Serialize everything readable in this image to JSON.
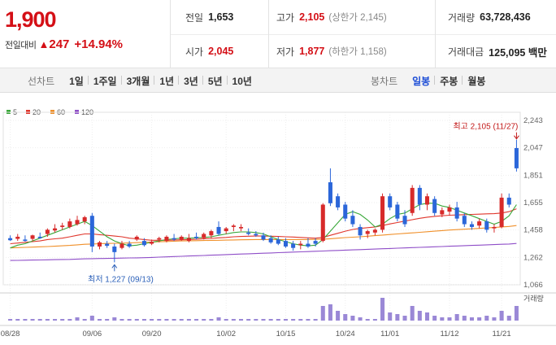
{
  "price": {
    "current": "1,900",
    "change_label": "전일대비",
    "arrow": "▲",
    "change": "247",
    "change_pct": "+14.94%"
  },
  "stats": {
    "prev_close_label": "전일",
    "prev_close": "1,653",
    "open_label": "시가",
    "open": "2,045",
    "high_label": "고가",
    "high": "2,105",
    "upper_limit": "(상한가 2,145)",
    "low_label": "저가",
    "low": "1,877",
    "lower_limit": "(하한가 1,158)",
    "volume_label": "거래량",
    "volume": "63,728,436",
    "amount_label": "거래대금",
    "amount": "125,095 백만"
  },
  "toolbar": {
    "period_label": "선차트",
    "periods": [
      "1일",
      "1주일",
      "3개월",
      "1년",
      "3년",
      "5년",
      "10년"
    ],
    "candle_label": "봉차트",
    "candles": [
      "일봉",
      "주봉",
      "월봉"
    ],
    "active_candle": "일봉"
  },
  "colors": {
    "up": "#d72a2a",
    "down": "#2b66d9",
    "ma5": "#3aa83a",
    "ma20": "#e0362c",
    "ma60": "#f0902a",
    "ma120": "#8f4ec8"
  },
  "chart_data": {
    "type": "candlestick",
    "legend": [
      "5",
      "20",
      "60",
      "120"
    ],
    "y_ticks": [
      "2,243",
      "2,047",
      "1,851",
      "1,655",
      "1,458",
      "1,262",
      "1,066"
    ],
    "ylim": [
      1066,
      2243
    ],
    "x_ticks": [
      "08/28",
      "09/06",
      "09/20",
      "10/02",
      "10/15",
      "10/24",
      "11/01",
      "11/12",
      "11/21"
    ],
    "annotations": {
      "high": "최고 2,105 (11/27)",
      "low": "최저 1,227 (09/13)"
    },
    "volume_label": "거래량",
    "candles": [
      [
        1400,
        1420,
        1380,
        1385
      ],
      [
        1395,
        1430,
        1380,
        1410
      ],
      [
        1390,
        1420,
        1375,
        1380
      ],
      [
        1395,
        1425,
        1380,
        1420
      ],
      [
        1410,
        1440,
        1395,
        1400
      ],
      [
        1430,
        1470,
        1410,
        1460
      ],
      [
        1455,
        1500,
        1440,
        1470
      ],
      [
        1480,
        1510,
        1460,
        1490
      ],
      [
        1480,
        1540,
        1470,
        1520
      ],
      [
        1500,
        1560,
        1490,
        1530
      ],
      [
        1520,
        1560,
        1500,
        1550
      ],
      [
        1560,
        1580,
        1300,
        1340
      ],
      [
        1340,
        1380,
        1320,
        1370
      ],
      [
        1360,
        1380,
        1330,
        1345
      ],
      [
        1340,
        1360,
        1227,
        1300
      ],
      [
        1330,
        1380,
        1320,
        1360
      ],
      [
        1360,
        1380,
        1330,
        1340
      ],
      [
        1390,
        1420,
        1380,
        1410
      ],
      [
        1380,
        1400,
        1340,
        1350
      ],
      [
        1360,
        1390,
        1350,
        1375
      ],
      [
        1390,
        1410,
        1370,
        1400
      ],
      [
        1380,
        1420,
        1370,
        1410
      ],
      [
        1400,
        1430,
        1380,
        1390
      ],
      [
        1390,
        1420,
        1380,
        1410
      ],
      [
        1380,
        1430,
        1370,
        1400
      ],
      [
        1410,
        1440,
        1390,
        1400
      ],
      [
        1400,
        1440,
        1390,
        1430
      ],
      [
        1420,
        1460,
        1400,
        1450
      ],
      [
        1480,
        1520,
        1420,
        1430
      ],
      [
        1450,
        1480,
        1430,
        1470
      ],
      [
        1480,
        1500,
        1450,
        1490
      ],
      [
        1470,
        1500,
        1450,
        1480
      ],
      [
        1440,
        1470,
        1420,
        1430
      ],
      [
        1430,
        1450,
        1410,
        1420
      ],
      [
        1420,
        1440,
        1380,
        1390
      ],
      [
        1400,
        1420,
        1360,
        1370
      ],
      [
        1390,
        1410,
        1350,
        1360
      ],
      [
        1380,
        1400,
        1330,
        1340
      ],
      [
        1360,
        1380,
        1310,
        1330
      ],
      [
        1350,
        1380,
        1320,
        1360
      ],
      [
        1360,
        1400,
        1330,
        1340
      ],
      [
        1380,
        1400,
        1340,
        1360
      ],
      [
        1380,
        1650,
        1370,
        1640
      ],
      [
        1800,
        1900,
        1630,
        1650
      ],
      [
        1700,
        1720,
        1600,
        1620
      ],
      [
        1640,
        1660,
        1520,
        1540
      ],
      [
        1560,
        1600,
        1480,
        1500
      ],
      [
        1480,
        1500,
        1390,
        1420
      ],
      [
        1430,
        1460,
        1400,
        1450
      ],
      [
        1440,
        1470,
        1420,
        1460
      ],
      [
        1460,
        1720,
        1440,
        1700
      ],
      [
        1700,
        1720,
        1600,
        1620
      ],
      [
        1640,
        1660,
        1520,
        1540
      ],
      [
        1560,
        1600,
        1480,
        1500
      ],
      [
        1580,
        1780,
        1560,
        1760
      ],
      [
        1760,
        1780,
        1600,
        1640
      ],
      [
        1640,
        1720,
        1600,
        1700
      ],
      [
        1680,
        1700,
        1560,
        1580
      ],
      [
        1570,
        1620,
        1550,
        1600
      ],
      [
        1590,
        1640,
        1560,
        1620
      ],
      [
        1620,
        1660,
        1520,
        1540
      ],
      [
        1560,
        1580,
        1480,
        1500
      ],
      [
        1500,
        1520,
        1460,
        1480
      ],
      [
        1490,
        1540,
        1470,
        1520
      ],
      [
        1520,
        1540,
        1440,
        1460
      ],
      [
        1470,
        1500,
        1440,
        1480
      ],
      [
        1480,
        1720,
        1470,
        1690
      ],
      [
        1690,
        1720,
        1620,
        1640
      ],
      [
        2045,
        2105,
        1877,
        1900
      ]
    ],
    "ma5": [
      1330,
      1350,
      1360,
      1380,
      1400,
      1420,
      1440,
      1460,
      1480,
      1500,
      1520,
      1490,
      1450,
      1410,
      1380,
      1360,
      1345,
      1350,
      1360,
      1370,
      1380,
      1390,
      1395,
      1400,
      1400,
      1402,
      1405,
      1410,
      1420,
      1430,
      1440,
      1445,
      1445,
      1440,
      1430,
      1410,
      1390,
      1375,
      1360,
      1350,
      1345,
      1350,
      1390,
      1450,
      1510,
      1570,
      1590,
      1570,
      1530,
      1480,
      1500,
      1540,
      1570,
      1580,
      1610,
      1640,
      1650,
      1650,
      1630,
      1620,
      1600,
      1580,
      1560,
      1540,
      1520,
      1500,
      1520,
      1560,
      1640
    ],
    "ma20": [
      1360,
      1365,
      1370,
      1375,
      1380,
      1390,
      1395,
      1400,
      1410,
      1420,
      1430,
      1430,
      1425,
      1420,
      1415,
      1410,
      1400,
      1395,
      1390,
      1385,
      1385,
      1385,
      1386,
      1388,
      1390,
      1392,
      1395,
      1398,
      1402,
      1405,
      1410,
      1412,
      1414,
      1415,
      1415,
      1414,
      1412,
      1410,
      1408,
      1405,
      1402,
      1400,
      1405,
      1420,
      1435,
      1450,
      1462,
      1470,
      1475,
      1480,
      1490,
      1502,
      1512,
      1522,
      1532,
      1542,
      1550,
      1556,
      1560,
      1564,
      1566,
      1568,
      1570,
      1572,
      1574,
      1575,
      1580,
      1590,
      1610
    ],
    "ma60": [
      1330,
      1332,
      1334,
      1336,
      1338,
      1340,
      1342,
      1345,
      1348,
      1352,
      1356,
      1358,
      1360,
      1362,
      1363,
      1364,
      1366,
      1368,
      1370,
      1372,
      1374,
      1376,
      1378,
      1380,
      1381,
      1382,
      1383,
      1384,
      1385,
      1386,
      1387,
      1388,
      1389,
      1390,
      1390,
      1390,
      1390,
      1390,
      1390,
      1390,
      1390,
      1391,
      1393,
      1396,
      1400,
      1404,
      1407,
      1410,
      1414,
      1418,
      1422,
      1426,
      1430,
      1434,
      1438,
      1442,
      1446,
      1450,
      1454,
      1458,
      1461,
      1464,
      1467,
      1470,
      1473,
      1476,
      1480,
      1484,
      1490
    ],
    "ma120": [
      1240,
      1241,
      1242,
      1243,
      1244,
      1245,
      1246,
      1247,
      1248,
      1250,
      1252,
      1253,
      1254,
      1255,
      1256,
      1257,
      1258,
      1259,
      1260,
      1262,
      1264,
      1266,
      1268,
      1270,
      1272,
      1274,
      1276,
      1278,
      1280,
      1282,
      1284,
      1286,
      1288,
      1290,
      1292,
      1294,
      1296,
      1298,
      1300,
      1302,
      1304,
      1306,
      1308,
      1310,
      1312,
      1314,
      1316,
      1318,
      1320,
      1322,
      1324,
      1326,
      1328,
      1330,
      1332,
      1334,
      1336,
      1338,
      1340,
      1342,
      1344,
      1346,
      1348,
      1350,
      1352,
      1354,
      1356,
      1358,
      1362
    ],
    "volume": [
      1,
      1,
      1,
      1,
      1,
      1,
      1,
      1,
      1,
      2,
      1,
      3,
      1,
      1,
      2,
      1,
      1,
      1,
      1,
      1,
      1,
      1,
      1,
      1,
      1,
      1,
      1,
      1,
      2,
      1,
      1,
      1,
      1,
      1,
      1,
      1,
      1,
      1,
      1,
      1,
      1,
      1,
      9,
      10,
      6,
      4,
      3,
      2,
      1,
      1,
      14,
      5,
      4,
      3,
      9,
      6,
      5,
      3,
      2,
      2,
      4,
      3,
      2,
      2,
      3,
      2,
      6,
      3,
      9
    ]
  }
}
